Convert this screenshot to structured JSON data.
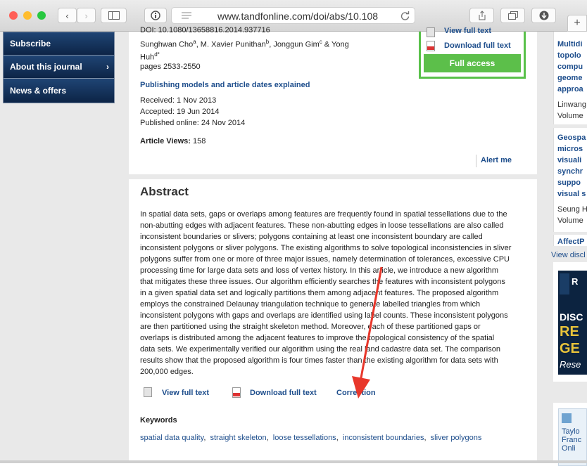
{
  "browser": {
    "url": "www.tandfonline.com/doi/abs/10.108",
    "traffic_colors": [
      "#ff5f57",
      "#ffbd2e",
      "#28c840"
    ]
  },
  "leftnav": {
    "items": [
      {
        "label": "Subscribe"
      },
      {
        "label": "About this journal"
      },
      {
        "label": "News & offers"
      }
    ]
  },
  "article": {
    "doi_line": "DOI: 10.1080/13658816.2014.937716",
    "authors_1": "Sunghwan Cho",
    "authors_1_sup": "a",
    "authors_2": ", M. Xavier Punithan",
    "authors_2_sup": "b",
    "authors_3": ", Jonggun Gim",
    "authors_3_sup": "c",
    "authors_4": " & Yong",
    "authors_5": "Huh",
    "authors_5_sup": "d*",
    "pages": "pages 2533-2550",
    "publishing_link": "Publishing models and article dates explained",
    "received": "Received: 1 Nov 2013",
    "accepted": "Accepted: 19 Jun 2014",
    "published": "Published online: 24 Nov 2014",
    "views_label": "Article Views:",
    "views_value": "158",
    "alert": "Alert me"
  },
  "access_box": {
    "view_full_text": "View full text",
    "download_full_text": "Download full text",
    "full_access": "Full access"
  },
  "abstract": {
    "heading": "Abstract",
    "lines": [
      "In spatial data sets, gaps or overlaps among features are frequently found in spatial tessellations due to the",
      "non-abutting edges with adjacent features. These non-abutting edges in loose tessellations are also called",
      "inconsistent boundaries or slivers; polygons containing at least one inconsistent boundary are called",
      "inconsistent polygons or sliver polygons. The existing algorithms to solve topological inconsistencies in sliver",
      "polygons suffer from one or more of three major issues, namely determination of tolerances, excessive CPU",
      "processing time for large data sets and loss of vertex history. In this article, we introduce a new algorithm",
      "that mitigates these three issues. Our algorithm efficiently searches the features with inconsistent polygons",
      "in a given spatial data set and logically partitions them among adjacent features. The proposed algorithm",
      "employs the constrained Delaunay triangulation technique to generate labelled triangles from which",
      "inconsistent polygons with gaps and overlaps are identified using label counts. These inconsistent polygons",
      "are then partitioned using the straight skeleton method. Moreover, each of these partitioned gaps or",
      "overlaps is distributed among the adjacent features to improve the topological consistency of the spatial",
      "data sets. We experimentally verified our algorithm using the real land cadastre data set. The comparison",
      "results show that the proposed algorithm is four times faster than the existing algorithm for data sets with",
      "200,000 edges."
    ],
    "view_full_text": "View full text",
    "download_full_text": "Download full text",
    "correction": "Correction",
    "keywords_heading": "Keywords",
    "keywords": [
      "spatial data quality",
      "straight skeleton",
      "loose tessellations",
      "inconsistent boundaries",
      "sliver polygons"
    ],
    "keyword_separator": ","
  },
  "right_column": {
    "card1_lines": [
      "Multidi",
      "topolo",
      "compu",
      "geome",
      "approa"
    ],
    "card1_author": "Linwang",
    "card1_volume": "Volume",
    "card2_lines": [
      "Geospa",
      "micros",
      "visuali",
      "synchr",
      "suppo",
      "visual s"
    ],
    "card2_author": "Seung H",
    "card2_volume": "Volume",
    "card3_title": "AffectP",
    "view_link": "View discl",
    "ad1_lines": [
      "DISC",
      "RE",
      "GE",
      "Rese"
    ],
    "ad1_small": "R",
    "ad2_lines": [
      "Taylo",
      "Franc",
      "Onli"
    ]
  },
  "annotation": {
    "arrow_color": "#e8372b"
  }
}
